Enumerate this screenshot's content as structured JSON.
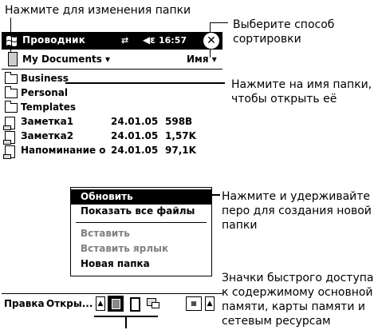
{
  "callouts": {
    "change_folder": "Нажмите для изменения папки",
    "sort_method": [
      "Выберите способ",
      "сортировки"
    ],
    "folder_name": [
      "Нажмите на имя папки,",
      "чтобы открыть её"
    ],
    "new_folder": [
      "Нажмите и удерживайте",
      "перо для создания новой",
      "папки"
    ],
    "quick_access": [
      "Значки быстрого доступа",
      "к содержимому основной",
      "памяти, карты памяти и",
      "сетевым ресурсам"
    ]
  },
  "titlebar": {
    "title": "Проводник",
    "clock": "16:57"
  },
  "folderbar": {
    "folder": "My Documents ▾",
    "sort": "Имя ▾"
  },
  "files": [
    {
      "name": "Business",
      "type": "folder",
      "date": "",
      "size": ""
    },
    {
      "name": "Personal",
      "type": "folder",
      "date": "",
      "size": ""
    },
    {
      "name": "Templates",
      "type": "folder",
      "date": "",
      "size": ""
    },
    {
      "name": "Заметка1",
      "type": "doc",
      "date": "24.01.05",
      "size": "598B"
    },
    {
      "name": "Заметка2",
      "type": "doc",
      "date": "24.01.05",
      "size": "1,57K"
    },
    {
      "name": "Напоминание о",
      "type": "doc",
      "date": "24.01.05",
      "size": "97,1K"
    }
  ],
  "context_menu": {
    "refresh": "Обновить",
    "show_all": "Показать все файлы",
    "paste": "Вставить",
    "paste_shortcut": "Вставить ярлык",
    "new_folder": "Новая папка"
  },
  "cmdbar": {
    "edit": "Правка",
    "open": "Откры..."
  },
  "colors": {
    "titlebar": "#000000",
    "selection": "#000000",
    "disabled": "#808080"
  }
}
